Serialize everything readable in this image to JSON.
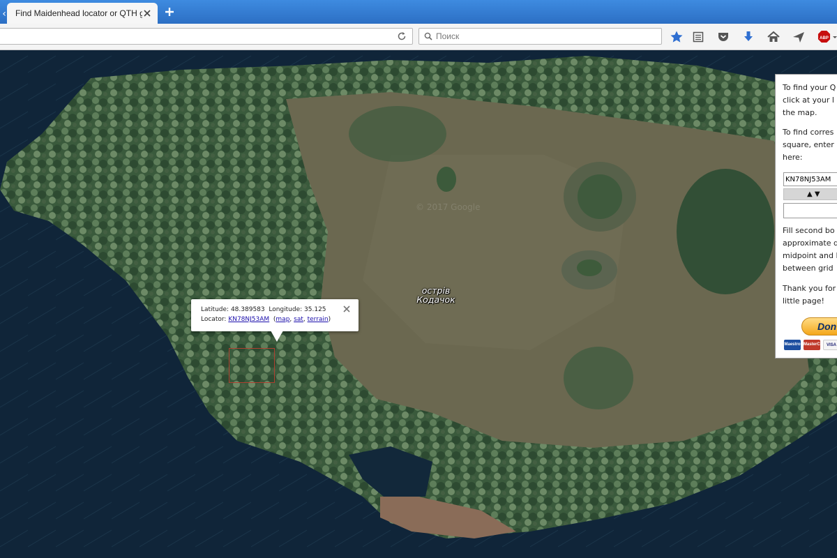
{
  "tab": {
    "title": "Find Maidenhead locator or QTH g..."
  },
  "search": {
    "placeholder": "Поиск"
  },
  "toolbar": {
    "abp_label": "ABP"
  },
  "map": {
    "island_label_line1": "острів",
    "island_label_line2": "Кодачок",
    "watermark": "© 2017 Google"
  },
  "infowindow": {
    "latitude_label": "Latitude:",
    "latitude_value": "48.389583",
    "longitude_label": "Longitude:",
    "longitude_value": "35.125",
    "locator_label": "Locator:",
    "locator_value": "KN78NJ53AM",
    "link_map": "map",
    "link_sat": "sat",
    "link_terrain": "terrain"
  },
  "panel": {
    "text1_line1": "To find your Q",
    "text1_line2": "click at your l",
    "text1_line3": "the map.",
    "text2_line1": "To find corres",
    "text2_line2": "square, enter",
    "text2_line3": "here:",
    "locator_input_value": "KN78NJ53AM",
    "arrows": "▲ ▼",
    "text3_line1": "Fill second bo",
    "text3_line2": "approximate d",
    "text3_line3": "midpoint and l",
    "text3_line4": "between grid",
    "text4_line1": "Thank you for",
    "text4_line2": "little page!",
    "donate_label": "Don",
    "card_maestro": "Maestro",
    "card_mastercard": "MasterCard",
    "card_visa": "VISA"
  }
}
